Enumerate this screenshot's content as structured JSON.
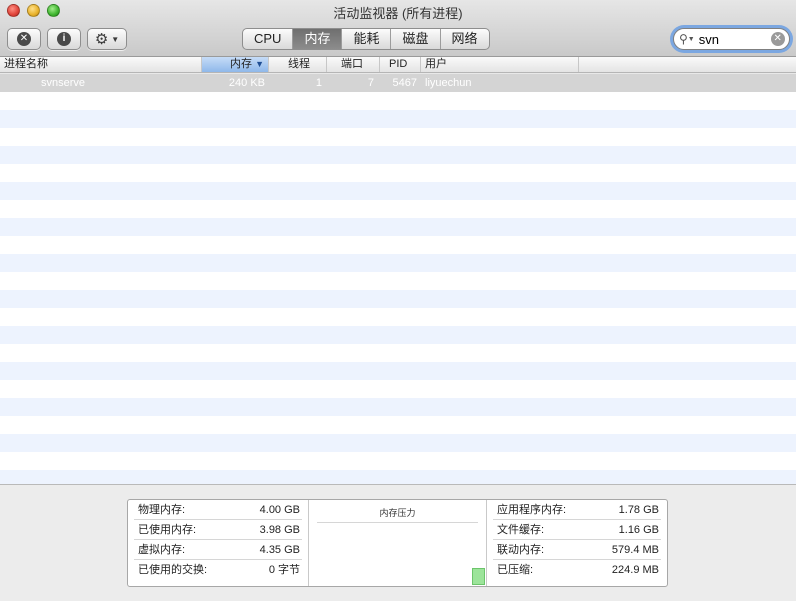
{
  "window": {
    "title": "活动监视器 (所有进程)"
  },
  "toolbar": {
    "stop_icon": "close-circle-icon",
    "info_icon": "info-circle-icon",
    "gear_icon": "gear-icon",
    "tabs": [
      {
        "label": "CPU",
        "active": false
      },
      {
        "label": "内存",
        "active": true
      },
      {
        "label": "能耗",
        "active": false
      },
      {
        "label": "磁盘",
        "active": false
      },
      {
        "label": "网络",
        "active": false
      }
    ],
    "search": {
      "value": "svn",
      "placeholder": ""
    }
  },
  "table": {
    "columns": {
      "name": "进程名称",
      "memory": "内存",
      "threads": "线程",
      "ports": "端口",
      "pid": "PID",
      "user": "用户"
    },
    "sort_indicator": "▼",
    "rows": [
      {
        "name": "svnserve",
        "memory": "240 KB",
        "threads": "1",
        "ports": "7",
        "pid": "5467",
        "user": "liyuechun"
      }
    ]
  },
  "stats": {
    "physical_memory": {
      "label": "物理内存:",
      "value": "4.00 GB"
    },
    "memory_used": {
      "label": "已使用内存:",
      "value": "3.98 GB"
    },
    "virtual_memory": {
      "label": "虚拟内存:",
      "value": "4.35 GB"
    },
    "swap_used": {
      "label": "已使用的交换:",
      "value": "0 字节"
    },
    "pressure_title": "内存压力",
    "app_memory": {
      "label": "应用程序内存:",
      "value": "1.78 GB"
    },
    "file_cache": {
      "label": "文件缓存:",
      "value": "1.16 GB"
    },
    "wired_memory": {
      "label": "联动内存:",
      "value": "579.4 MB"
    },
    "compressed": {
      "label": "已压缩:",
      "value": "224.9 MB"
    }
  },
  "colors": {
    "selected_tab": "#7a7a7a",
    "sorted_header": "#a9c9f0",
    "pressure_green": "#9ce49a",
    "alt_row": "#edf3fe"
  }
}
